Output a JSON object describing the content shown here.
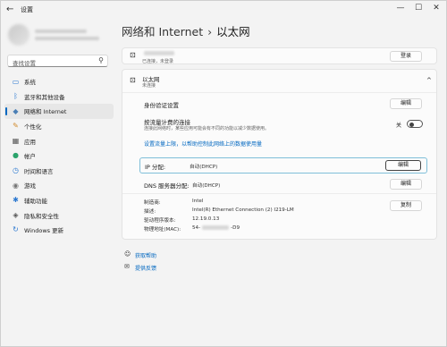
{
  "window": {
    "title": "设置",
    "back_icon": "back-arrow-icon",
    "controls": [
      "—",
      "☐",
      "✕"
    ]
  },
  "sidebar": {
    "search_placeholder": "查找设置",
    "items": [
      {
        "label": "系统",
        "icon": "monitor-icon",
        "glyph": "▭",
        "color": "#2b78d0",
        "active": false
      },
      {
        "label": "蓝牙和其他设备",
        "icon": "bluetooth-icon",
        "glyph": "ᛒ",
        "color": "#2b78d0",
        "active": false
      },
      {
        "label": "网络和 Internet",
        "icon": "wifi-icon",
        "glyph": "◆",
        "color": "#4a7fb5",
        "active": true
      },
      {
        "label": "个性化",
        "icon": "brush-icon",
        "glyph": "✎",
        "color": "#d08a2b",
        "active": false
      },
      {
        "label": "应用",
        "icon": "apps-icon",
        "glyph": "▦",
        "color": "#555555",
        "active": false
      },
      {
        "label": "帐户",
        "icon": "account-icon",
        "glyph": "●",
        "color": "#2ba36b",
        "active": false
      },
      {
        "label": "时间和语言",
        "icon": "globe-clock-icon",
        "glyph": "◷",
        "color": "#2b78d0",
        "active": false
      },
      {
        "label": "游戏",
        "icon": "gamepad-icon",
        "glyph": "◉",
        "color": "#777777",
        "active": false
      },
      {
        "label": "辅助功能",
        "icon": "accessibility-icon",
        "glyph": "✱",
        "color": "#2b78d0",
        "active": false
      },
      {
        "label": "隐私和安全性",
        "icon": "shield-icon",
        "glyph": "◈",
        "color": "#555555",
        "active": false
      },
      {
        "label": "Windows 更新",
        "icon": "update-icon",
        "glyph": "↻",
        "color": "#2b78d0",
        "active": false
      }
    ]
  },
  "breadcrumb": {
    "parent": "网络和 Internet",
    "separator": "›",
    "current": "以太网"
  },
  "status_card": {
    "name_blurred": true,
    "status": "已连接，未登录",
    "button": "登录"
  },
  "ethernet": {
    "title": "以太网",
    "subtitle": "未连接",
    "chevron": "^",
    "auth": {
      "label": "身份验证设置",
      "button": "编辑"
    },
    "metered": {
      "label": "按流量计费的连接",
      "desc": "连接此网络时，某些应用可能会有不同的功能以减少数据使用。",
      "toggle_label": "关",
      "toggle_on": false
    },
    "data_limit_link": "设置流量上限，以帮助控制此网络上的数据使用量",
    "ip": {
      "label": "IP 分配:",
      "value": "自动(DHCP)",
      "button": "编辑"
    },
    "dns": {
      "label": "DNS 服务器分配:",
      "value": "自动(DHCP)",
      "button": "编辑"
    },
    "props": [
      {
        "key": "制造商:",
        "value": "Intel"
      },
      {
        "key": "描述:",
        "value": "Intel(R) Ethernet Connection (2) I219-LM"
      },
      {
        "key": "驱动程序版本:",
        "value": "12.19.0.13"
      },
      {
        "key": "物理地址(MAC):",
        "value_prefix": "54-",
        "value_suffix": "-D9"
      }
    ],
    "copy_button": "复制"
  },
  "help": [
    {
      "label": "获取帮助",
      "icon": "help-person-icon"
    },
    {
      "label": "提供反馈",
      "icon": "feedback-icon"
    }
  ]
}
